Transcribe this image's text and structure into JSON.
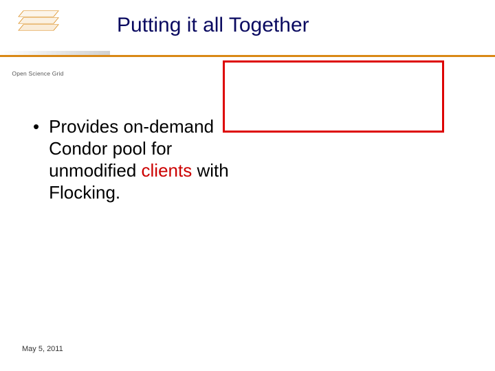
{
  "header": {
    "logo_text": "Open Science Grid",
    "title": "Putting it all Together"
  },
  "content": {
    "bullet_pre": "Provides on-demand Condor pool for unmodified ",
    "bullet_highlight": "clients",
    "bullet_post": " with Flocking."
  },
  "footer": {
    "date": "May 5, 2011"
  }
}
